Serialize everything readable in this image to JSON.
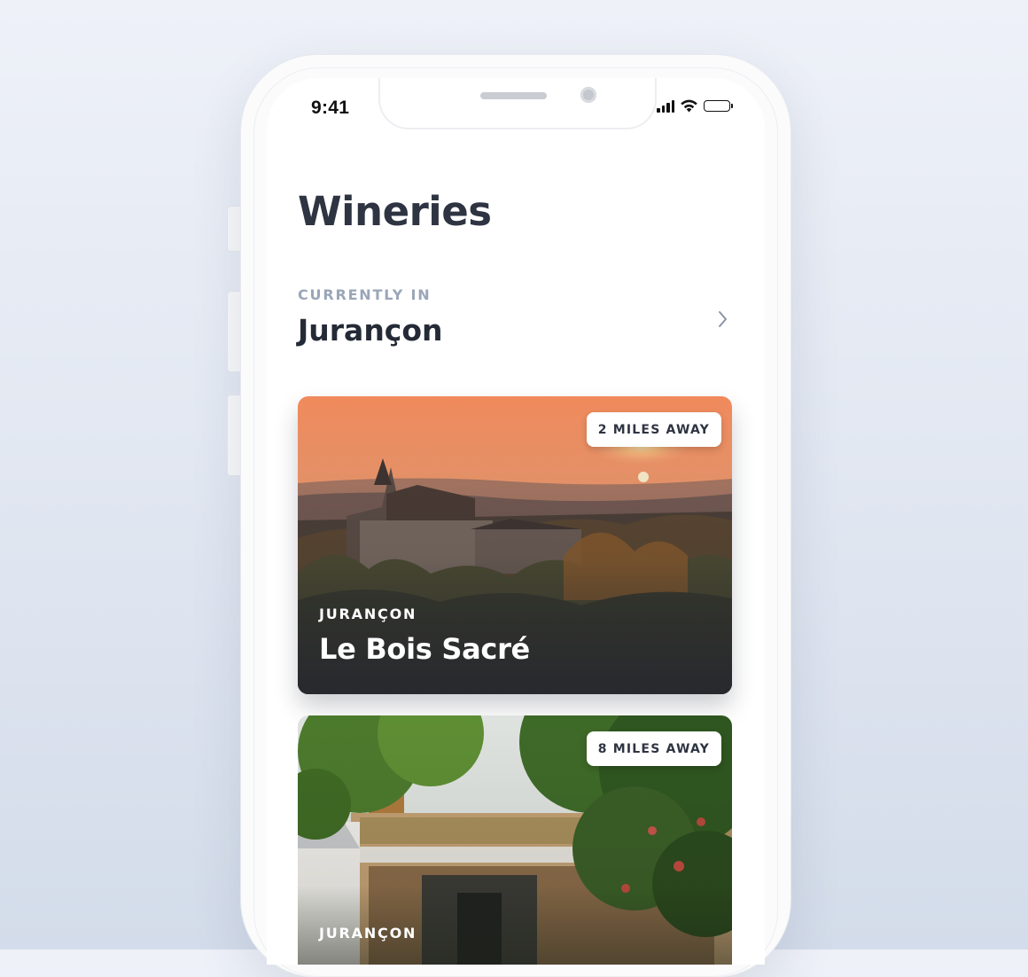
{
  "status_bar": {
    "time": "9:41",
    "signal_icon": "cellular-signal-icon",
    "wifi_icon": "wifi-icon",
    "battery_icon": "battery-icon"
  },
  "header": {
    "title": "Wineries"
  },
  "location": {
    "caption": "CURRENTLY IN",
    "name": "Jurançon",
    "chevron_icon": "chevron-right-icon"
  },
  "wineries": [
    {
      "region": "JURANÇON",
      "name": "Le Bois Sacré",
      "distance": "2 MILES AWAY",
      "image": "castle-at-sunset-photo"
    },
    {
      "region": "JURANÇON",
      "name": "",
      "distance": "8 MILES AWAY",
      "image": "winery-building-among-trees-photo"
    }
  ],
  "colors": {
    "title": "#2e3441",
    "caption": "#9aa6b8",
    "background": "#e6ebf3"
  }
}
